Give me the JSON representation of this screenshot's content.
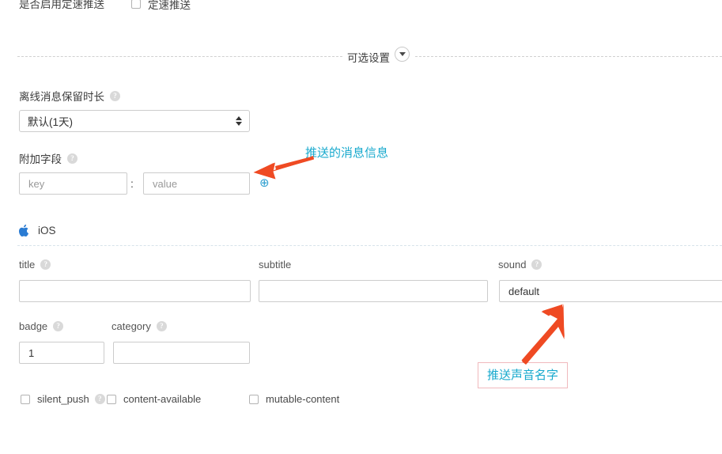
{
  "top_row": {
    "label": "是否启用定速推送",
    "checkbox_label": "定速推送",
    "checked": false
  },
  "optional_section": {
    "title": "可选设置",
    "toggle_icon": "chevron-down-icon"
  },
  "retain_field": {
    "label": "离线消息保留时长",
    "help_icon": "help-icon",
    "help_glyph": "?",
    "selected_value": "默认(1天)",
    "options": [
      "默认(1天)"
    ]
  },
  "extra_field": {
    "label": "附加字段",
    "help_glyph": "?",
    "key_placeholder": "key",
    "key_value": "",
    "separator": ":",
    "value_placeholder": "value",
    "value_value": "",
    "add_icon": "plus-circle-icon",
    "add_glyph": "⊕"
  },
  "ios_section": {
    "icon": "apple-logo-icon",
    "name": "iOS",
    "fields": {
      "title": {
        "label": "title",
        "help_glyph": "?",
        "has_help": true,
        "value": "",
        "placeholder": ""
      },
      "subtitle": {
        "label": "subtitle",
        "has_help": false,
        "value": "",
        "placeholder": ""
      },
      "sound": {
        "label": "sound",
        "help_glyph": "?",
        "has_help": true,
        "value": "default",
        "placeholder": ""
      },
      "badge": {
        "label": "badge",
        "help_glyph": "?",
        "has_help": true,
        "value": "1",
        "placeholder": ""
      },
      "category": {
        "label": "category",
        "help_glyph": "?",
        "has_help": true,
        "value": "",
        "placeholder": ""
      }
    },
    "checkboxes": [
      {
        "label": "silent_push",
        "checked": false,
        "has_help": true,
        "help_glyph": "?"
      },
      {
        "label": "content-available",
        "checked": false,
        "has_help": false
      },
      {
        "label": "mutable-content",
        "checked": false,
        "has_help": false
      }
    ]
  },
  "annotations": [
    {
      "text": "推送的消息信息",
      "color": "#17a9cd",
      "arrow_color": "#ef4a23",
      "boxed": false
    },
    {
      "text": "推送声音名字",
      "color": "#17a9cd",
      "arrow_color": "#ef4a23",
      "boxed": true,
      "box_border": "#f0b9bd"
    }
  ],
  "colors": {
    "accent_blue": "#2f9fd0",
    "annotation_teal": "#17a9cd",
    "arrow_red": "#ef4a23",
    "border_grey": "#cccccc",
    "text_dark": "#333333"
  }
}
